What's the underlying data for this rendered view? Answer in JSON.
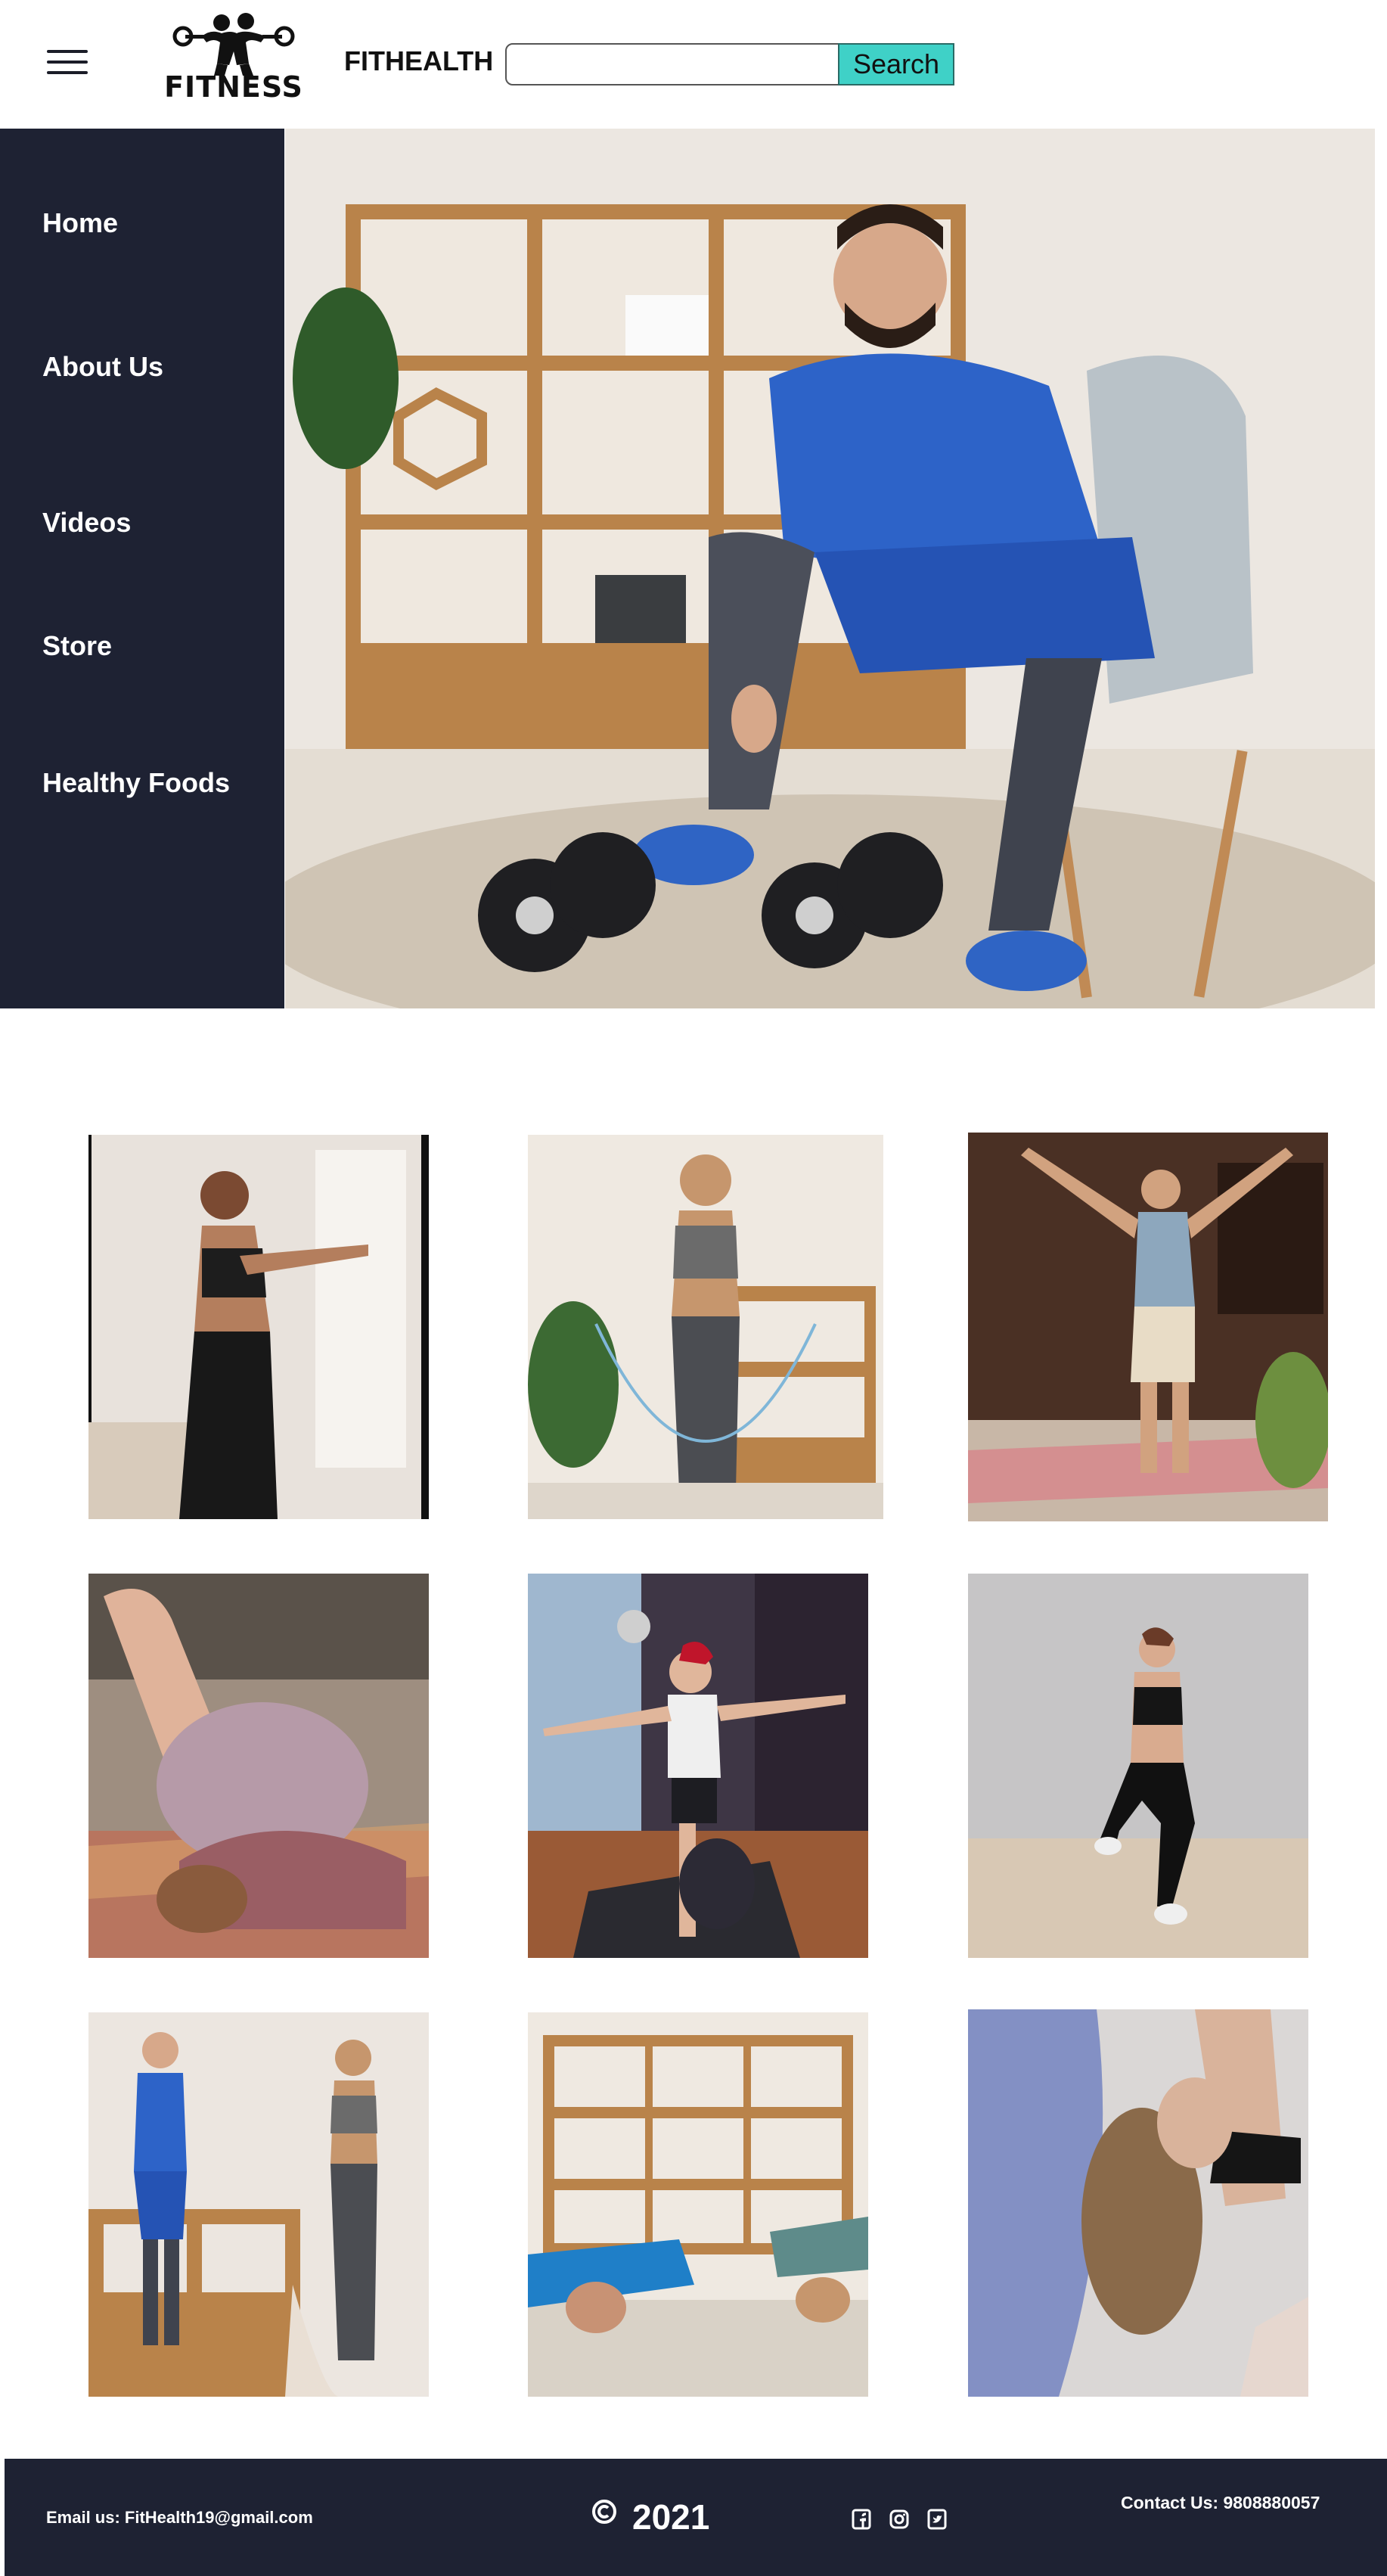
{
  "header": {
    "logo_text": "FITNESS",
    "brand_title": "FITHEALTH",
    "search": {
      "placeholder": "",
      "button_label": "Search"
    }
  },
  "sidebar": {
    "items": [
      {
        "label": "Home"
      },
      {
        "label": "About Us"
      },
      {
        "label": "Videos"
      },
      {
        "label": "Store"
      },
      {
        "label": "Healthy Foods"
      }
    ]
  },
  "gallery": {
    "images": [
      "woman-stretching-photo",
      "woman-jump-rope-photo",
      "man-arms-raised-photo",
      "woman-yoga-plough-photo",
      "man-balance-pose-photo",
      "woman-lunge-photo",
      "couple-talking-photo",
      "couple-pushups-photo",
      "woman-backbend-photo"
    ]
  },
  "footer": {
    "email": "Email us: FitHealth19@gmail.com",
    "year": "2021",
    "contact": "Contact Us: 9808880057",
    "social_icons": [
      "facebook-icon",
      "instagram-icon",
      "twitter-icon"
    ]
  },
  "colors": {
    "sidebar_bg": "#1e2233",
    "footer_bg": "#1e2233",
    "search_button": "#3fd1c7"
  }
}
